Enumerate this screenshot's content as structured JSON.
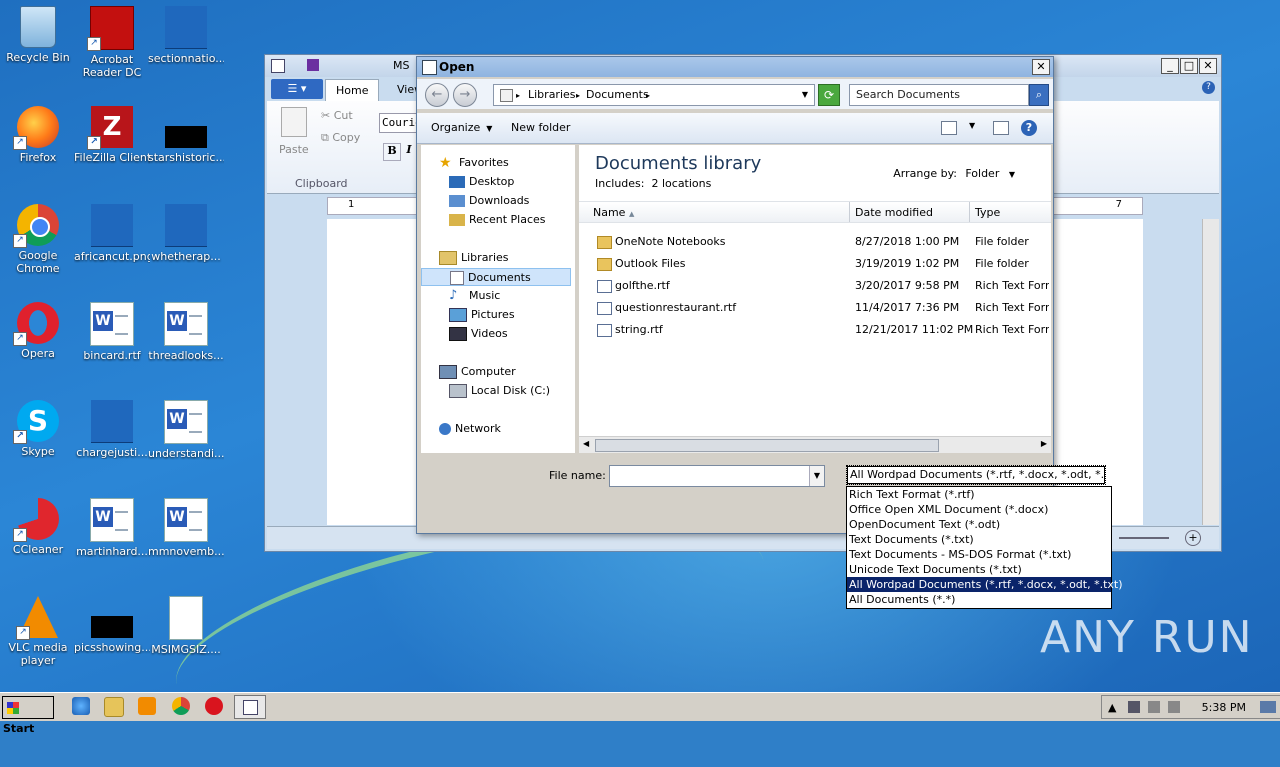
{
  "desktop": {
    "icons": [
      {
        "label": "Recycle Bin"
      },
      {
        "label": "Acrobat Reader DC"
      },
      {
        "label": "sectionnatio..."
      },
      {
        "label": "Firefox"
      },
      {
        "label": "FileZilla Client"
      },
      {
        "label": "starshistoric..."
      },
      {
        "label": "Google Chrome"
      },
      {
        "label": "africancut.png"
      },
      {
        "label": "whetherap..."
      },
      {
        "label": "Opera"
      },
      {
        "label": "bincard.rtf"
      },
      {
        "label": "threadlooks..."
      },
      {
        "label": "Skype"
      },
      {
        "label": "chargejusti..."
      },
      {
        "label": "understandi..."
      },
      {
        "label": "CCleaner"
      },
      {
        "label": "martinhard..."
      },
      {
        "label": "mmnovemb..."
      },
      {
        "label": "VLC media player"
      },
      {
        "label": "picsshowing..."
      },
      {
        "label": "MSIMGSIZ...."
      }
    ]
  },
  "wordpad": {
    "title_fragment": "MS",
    "tabs": {
      "home": "Home",
      "view": "View"
    },
    "ribbon": {
      "paste": "Paste",
      "cut": "Cut",
      "copy": "Copy",
      "clipboard_group": "Clipboard",
      "font_name": "Courier",
      "bold": "B",
      "italic": "I"
    },
    "ruler": {
      "left": "1",
      "right": "7"
    }
  },
  "dialog": {
    "title": "Open",
    "breadcrumb": [
      "Libraries",
      "Documents"
    ],
    "search_placeholder": "Search Documents",
    "toolbar": {
      "organize": "Organize",
      "new_folder": "New folder"
    },
    "nav": {
      "favorites": "Favorites",
      "desktop": "Desktop",
      "downloads": "Downloads",
      "recent_places": "Recent Places",
      "libraries": "Libraries",
      "documents": "Documents",
      "music": "Music",
      "pictures": "Pictures",
      "videos": "Videos",
      "computer": "Computer",
      "local_disk": "Local Disk (C:)",
      "network": "Network"
    },
    "library_title": "Documents library",
    "includes_label": "Includes:",
    "includes_value": "2 locations",
    "arrange_label": "Arrange by:",
    "arrange_value": "Folder",
    "columns": {
      "name": "Name",
      "date": "Date modified",
      "type": "Type"
    },
    "files": [
      {
        "name": "OneNote Notebooks",
        "date": "8/27/2018 1:00 PM",
        "type": "File folder",
        "kind": "folder"
      },
      {
        "name": "Outlook Files",
        "date": "3/19/2019 1:02 PM",
        "type": "File folder",
        "kind": "folder"
      },
      {
        "name": "golfthe.rtf",
        "date": "3/20/2017 9:58 PM",
        "type": "Rich Text Format",
        "kind": "rtf"
      },
      {
        "name": "questionrestaurant.rtf",
        "date": "11/4/2017 7:36 PM",
        "type": "Rich Text Format",
        "kind": "rtf"
      },
      {
        "name": "string.rtf",
        "date": "12/21/2017 11:02 PM",
        "type": "Rich Text Format",
        "kind": "rtf"
      }
    ],
    "filename_label": "File name:",
    "filename_value": "",
    "filetype_selected": "All Wordpad Documents (*.rtf, *.docx, *.odt, *.txt)",
    "filetype_options": [
      "Rich Text Format (*.rtf)",
      "Office Open XML Document (*.docx)",
      "OpenDocument Text (*.odt)",
      "Text Documents (*.txt)",
      "Text Documents - MS-DOS Format (*.txt)",
      "Unicode Text Documents (*.txt)",
      "All Wordpad Documents (*.rtf, *.docx, *.odt, *.txt)",
      "All Documents (*.*)"
    ]
  },
  "taskbar": {
    "start": "Start",
    "clock": "5:38 PM"
  },
  "watermark": "ANY RUN",
  "colors": {
    "selection": "#0a246a",
    "desktop": "#2b86d6",
    "taskbar": "#d4d0c8"
  }
}
